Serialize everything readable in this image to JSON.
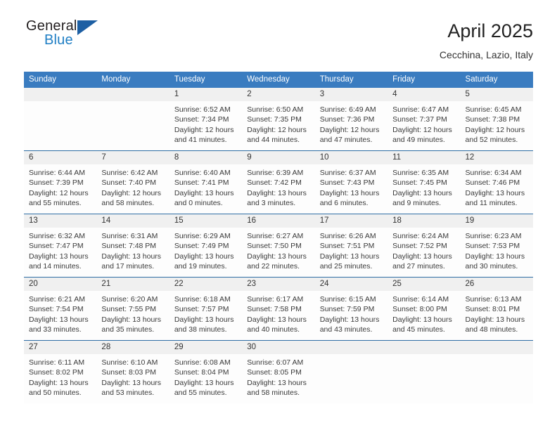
{
  "brand": {
    "name_top": "General",
    "name_bottom": "Blue",
    "triangle_icon": "blue-triangle-logo-mark",
    "accent_blue": "#1f7ec4",
    "triangle_blue": "#1d5fa3"
  },
  "header": {
    "title": "April 2025",
    "subtitle": "Cecchina, Lazio, Italy"
  },
  "theme": {
    "header_row_bg": "#3a7cc0",
    "week_divider": "#2e6da4",
    "daynum_band_bg": "#f0f0f0",
    "cell_bg": "#fdfdfd"
  },
  "weekday_headers": [
    "Sunday",
    "Monday",
    "Tuesday",
    "Wednesday",
    "Thursday",
    "Friday",
    "Saturday"
  ],
  "weeks": [
    [
      {
        "day": "",
        "sunrise": "",
        "sunset": "",
        "daylight_line1": "",
        "daylight_line2": ""
      },
      {
        "day": "",
        "sunrise": "",
        "sunset": "",
        "daylight_line1": "",
        "daylight_line2": ""
      },
      {
        "day": "1",
        "sunrise": "Sunrise: 6:52 AM",
        "sunset": "Sunset: 7:34 PM",
        "daylight_line1": "Daylight: 12 hours",
        "daylight_line2": "and 41 minutes."
      },
      {
        "day": "2",
        "sunrise": "Sunrise: 6:50 AM",
        "sunset": "Sunset: 7:35 PM",
        "daylight_line1": "Daylight: 12 hours",
        "daylight_line2": "and 44 minutes."
      },
      {
        "day": "3",
        "sunrise": "Sunrise: 6:49 AM",
        "sunset": "Sunset: 7:36 PM",
        "daylight_line1": "Daylight: 12 hours",
        "daylight_line2": "and 47 minutes."
      },
      {
        "day": "4",
        "sunrise": "Sunrise: 6:47 AM",
        "sunset": "Sunset: 7:37 PM",
        "daylight_line1": "Daylight: 12 hours",
        "daylight_line2": "and 49 minutes."
      },
      {
        "day": "5",
        "sunrise": "Sunrise: 6:45 AM",
        "sunset": "Sunset: 7:38 PM",
        "daylight_line1": "Daylight: 12 hours",
        "daylight_line2": "and 52 minutes."
      }
    ],
    [
      {
        "day": "6",
        "sunrise": "Sunrise: 6:44 AM",
        "sunset": "Sunset: 7:39 PM",
        "daylight_line1": "Daylight: 12 hours",
        "daylight_line2": "and 55 minutes."
      },
      {
        "day": "7",
        "sunrise": "Sunrise: 6:42 AM",
        "sunset": "Sunset: 7:40 PM",
        "daylight_line1": "Daylight: 12 hours",
        "daylight_line2": "and 58 minutes."
      },
      {
        "day": "8",
        "sunrise": "Sunrise: 6:40 AM",
        "sunset": "Sunset: 7:41 PM",
        "daylight_line1": "Daylight: 13 hours",
        "daylight_line2": "and 0 minutes."
      },
      {
        "day": "9",
        "sunrise": "Sunrise: 6:39 AM",
        "sunset": "Sunset: 7:42 PM",
        "daylight_line1": "Daylight: 13 hours",
        "daylight_line2": "and 3 minutes."
      },
      {
        "day": "10",
        "sunrise": "Sunrise: 6:37 AM",
        "sunset": "Sunset: 7:43 PM",
        "daylight_line1": "Daylight: 13 hours",
        "daylight_line2": "and 6 minutes."
      },
      {
        "day": "11",
        "sunrise": "Sunrise: 6:35 AM",
        "sunset": "Sunset: 7:45 PM",
        "daylight_line1": "Daylight: 13 hours",
        "daylight_line2": "and 9 minutes."
      },
      {
        "day": "12",
        "sunrise": "Sunrise: 6:34 AM",
        "sunset": "Sunset: 7:46 PM",
        "daylight_line1": "Daylight: 13 hours",
        "daylight_line2": "and 11 minutes."
      }
    ],
    [
      {
        "day": "13",
        "sunrise": "Sunrise: 6:32 AM",
        "sunset": "Sunset: 7:47 PM",
        "daylight_line1": "Daylight: 13 hours",
        "daylight_line2": "and 14 minutes."
      },
      {
        "day": "14",
        "sunrise": "Sunrise: 6:31 AM",
        "sunset": "Sunset: 7:48 PM",
        "daylight_line1": "Daylight: 13 hours",
        "daylight_line2": "and 17 minutes."
      },
      {
        "day": "15",
        "sunrise": "Sunrise: 6:29 AM",
        "sunset": "Sunset: 7:49 PM",
        "daylight_line1": "Daylight: 13 hours",
        "daylight_line2": "and 19 minutes."
      },
      {
        "day": "16",
        "sunrise": "Sunrise: 6:27 AM",
        "sunset": "Sunset: 7:50 PM",
        "daylight_line1": "Daylight: 13 hours",
        "daylight_line2": "and 22 minutes."
      },
      {
        "day": "17",
        "sunrise": "Sunrise: 6:26 AM",
        "sunset": "Sunset: 7:51 PM",
        "daylight_line1": "Daylight: 13 hours",
        "daylight_line2": "and 25 minutes."
      },
      {
        "day": "18",
        "sunrise": "Sunrise: 6:24 AM",
        "sunset": "Sunset: 7:52 PM",
        "daylight_line1": "Daylight: 13 hours",
        "daylight_line2": "and 27 minutes."
      },
      {
        "day": "19",
        "sunrise": "Sunrise: 6:23 AM",
        "sunset": "Sunset: 7:53 PM",
        "daylight_line1": "Daylight: 13 hours",
        "daylight_line2": "and 30 minutes."
      }
    ],
    [
      {
        "day": "20",
        "sunrise": "Sunrise: 6:21 AM",
        "sunset": "Sunset: 7:54 PM",
        "daylight_line1": "Daylight: 13 hours",
        "daylight_line2": "and 33 minutes."
      },
      {
        "day": "21",
        "sunrise": "Sunrise: 6:20 AM",
        "sunset": "Sunset: 7:55 PM",
        "daylight_line1": "Daylight: 13 hours",
        "daylight_line2": "and 35 minutes."
      },
      {
        "day": "22",
        "sunrise": "Sunrise: 6:18 AM",
        "sunset": "Sunset: 7:57 PM",
        "daylight_line1": "Daylight: 13 hours",
        "daylight_line2": "and 38 minutes."
      },
      {
        "day": "23",
        "sunrise": "Sunrise: 6:17 AM",
        "sunset": "Sunset: 7:58 PM",
        "daylight_line1": "Daylight: 13 hours",
        "daylight_line2": "and 40 minutes."
      },
      {
        "day": "24",
        "sunrise": "Sunrise: 6:15 AM",
        "sunset": "Sunset: 7:59 PM",
        "daylight_line1": "Daylight: 13 hours",
        "daylight_line2": "and 43 minutes."
      },
      {
        "day": "25",
        "sunrise": "Sunrise: 6:14 AM",
        "sunset": "Sunset: 8:00 PM",
        "daylight_line1": "Daylight: 13 hours",
        "daylight_line2": "and 45 minutes."
      },
      {
        "day": "26",
        "sunrise": "Sunrise: 6:13 AM",
        "sunset": "Sunset: 8:01 PM",
        "daylight_line1": "Daylight: 13 hours",
        "daylight_line2": "and 48 minutes."
      }
    ],
    [
      {
        "day": "27",
        "sunrise": "Sunrise: 6:11 AM",
        "sunset": "Sunset: 8:02 PM",
        "daylight_line1": "Daylight: 13 hours",
        "daylight_line2": "and 50 minutes."
      },
      {
        "day": "28",
        "sunrise": "Sunrise: 6:10 AM",
        "sunset": "Sunset: 8:03 PM",
        "daylight_line1": "Daylight: 13 hours",
        "daylight_line2": "and 53 minutes."
      },
      {
        "day": "29",
        "sunrise": "Sunrise: 6:08 AM",
        "sunset": "Sunset: 8:04 PM",
        "daylight_line1": "Daylight: 13 hours",
        "daylight_line2": "and 55 minutes."
      },
      {
        "day": "30",
        "sunrise": "Sunrise: 6:07 AM",
        "sunset": "Sunset: 8:05 PM",
        "daylight_line1": "Daylight: 13 hours",
        "daylight_line2": "and 58 minutes."
      },
      {
        "day": "",
        "sunrise": "",
        "sunset": "",
        "daylight_line1": "",
        "daylight_line2": ""
      },
      {
        "day": "",
        "sunrise": "",
        "sunset": "",
        "daylight_line1": "",
        "daylight_line2": ""
      },
      {
        "day": "",
        "sunrise": "",
        "sunset": "",
        "daylight_line1": "",
        "daylight_line2": ""
      }
    ]
  ]
}
